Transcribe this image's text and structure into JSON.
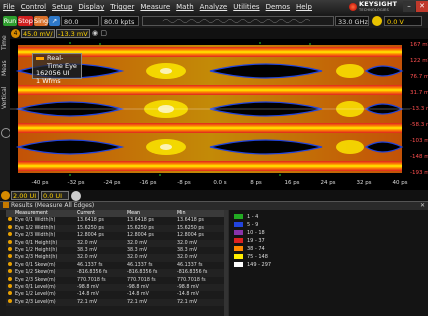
{
  "menu": [
    "File",
    "Control",
    "Setup",
    "Display",
    "Trigger",
    "Measure",
    "Math",
    "Analyze",
    "Utilities",
    "Demos",
    "Help"
  ],
  "brand": {
    "name": "KEYSIGHT",
    "sub": "TECHNOLOGIES"
  },
  "toolbar": {
    "run": "Run",
    "stop": "Stop",
    "single": "Single",
    "sample_rate": "80.0 GSa/s",
    "memory": "80.0 kpts",
    "bandwidth": "33.0 GHz",
    "trigger_level": "0.0 V"
  },
  "channel": {
    "number": "4",
    "scale": "45.0 mV/",
    "offset": "-13.3 mV"
  },
  "side_tabs": {
    "time": "Time",
    "meas": "Meas",
    "vertical": "Vertical Meas"
  },
  "eye_legend": {
    "title": "Real-Time Eye",
    "ui": "162056 UI",
    "wfms": "1 Wfms"
  },
  "y_labels": [
    "167 mV",
    "122 mV",
    "76.7 mV",
    "31.7 mV",
    "-13.3 mV",
    "-58.3 mV",
    "-103 mV",
    "-148 mV",
    "-193 mV"
  ],
  "x_labels": [
    "-40 ps",
    "-32 ps",
    "-24 ps",
    "-16 ps",
    "-8 ps",
    "0.0 s",
    "8 ps",
    "16 ps",
    "24 ps",
    "32 ps",
    "40 ps"
  ],
  "controls": {
    "position": "2.00 UI",
    "offset": "0.0 UI"
  },
  "results": {
    "title": "Results",
    "subtitle": "(Measure All Edges)",
    "columns": [
      "Measurement",
      "Current",
      "Mean",
      "Min"
    ],
    "rows": [
      [
        "Eye 0/1 Width(h)",
        "13.6418 ps",
        "13.6418 ps",
        "13.6418 ps"
      ],
      [
        "Eye 1/2 Width(h)",
        "15.6250 ps",
        "15.6250 ps",
        "15.6250 ps"
      ],
      [
        "Eye 2/3 Width(h)",
        "12.8004 ps",
        "12.8004 ps",
        "12.8004 ps"
      ],
      [
        "Eye 0/1 Height(h)",
        "32.0 mV",
        "32.0 mV",
        "32.0 mV"
      ],
      [
        "Eye 1/2 Height(h)",
        "38.3 mV",
        "38.3 mV",
        "38.3 mV"
      ],
      [
        "Eye 2/3 Height(h)",
        "32.0 mV",
        "32.0 mV",
        "32.0 mV"
      ],
      [
        "Eye 0/1 Skew(m)",
        "46.1337 fs",
        "46.1337 fs",
        "46.1337 fs"
      ],
      [
        "Eye 1/2 Skew(m)",
        "-816.8356 fs",
        "-816.8356 fs",
        "-816.8356 fs"
      ],
      [
        "Eye 2/3 Skew(m)",
        "770.7018 fs",
        "770.7018 fs",
        "770.7018 fs"
      ],
      [
        "Eye 0/1 Level(m)",
        "-98.8 mV",
        "-98.8 mV",
        "-98.8 mV"
      ],
      [
        "Eye 1/2 Level(m)",
        "-14.8 mV",
        "-14.8 mV",
        "-14.8 mV"
      ],
      [
        "Eye 2/3 Level(m)",
        "72.1 mV",
        "72.1 mV",
        "72.1 mV"
      ]
    ]
  },
  "color_legend": [
    {
      "label": "1 - 4",
      "color": "#22aa22"
    },
    {
      "label": "5 - 9",
      "color": "#2244dd"
    },
    {
      "label": "10 - 18",
      "color": "#8833aa"
    },
    {
      "label": "19 - 37",
      "color": "#dd2222"
    },
    {
      "label": "38 - 74",
      "color": "#ff8800"
    },
    {
      "label": "75 - 148",
      "color": "#ffee00"
    },
    {
      "label": "149 - 297",
      "color": "#ffffff"
    }
  ]
}
